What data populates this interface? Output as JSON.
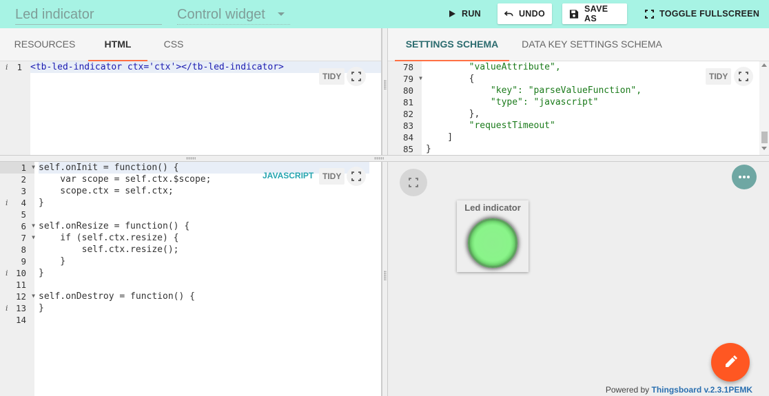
{
  "toolbar": {
    "widget_name": "Led indicator",
    "widget_type": "Control widget",
    "run_label": "RUN",
    "undo_label": "UNDO",
    "save_as_label": "SAVE AS",
    "fullscreen_label": "TOGGLE FULLSCREEN"
  },
  "html_pane": {
    "tabs": [
      "RESOURCES",
      "HTML",
      "CSS"
    ],
    "active_tab": "HTML",
    "tidy_label": "TIDY",
    "lines": [
      {
        "num": "1"
      }
    ],
    "code_text": "<tb-led-indicator ctx='ctx'></tb-led-indicator>"
  },
  "settings_pane": {
    "tabs": [
      "SETTINGS SCHEMA",
      "DATA KEY SETTINGS SCHEMA"
    ],
    "active_tab": "SETTINGS SCHEMA",
    "tidy_label": "TIDY",
    "line_numbers": [
      "78",
      "79",
      "80",
      "81",
      "82",
      "83",
      "84",
      "85"
    ],
    "code_lines": [
      "        \"valueAttribute\",",
      "        {",
      "            \"key\": \"parseValueFunction\",",
      "            \"type\": \"javascript\"",
      "        },",
      "        \"requestTimeout\"",
      "    ]",
      "}"
    ]
  },
  "js_pane": {
    "javascript_label": "JAVASCRIPT",
    "tidy_label": "TIDY",
    "line_numbers": [
      "1",
      "2",
      "3",
      "4",
      "5",
      "6",
      "7",
      "8",
      "9",
      "10",
      "11",
      "12",
      "13",
      "14"
    ],
    "code_lines": [
      "self.onInit = function() {",
      "    var scope = self.ctx.$scope;",
      "    scope.ctx = self.ctx;",
      "}",
      "",
      "self.onResize = function() {",
      "    if (self.ctx.resize) {",
      "        self.ctx.resize();",
      "    }",
      "}",
      "",
      "self.onDestroy = function() {",
      "}",
      ""
    ]
  },
  "preview": {
    "widget_title": "Led indicator",
    "led_color": "#8af48a",
    "powered_prefix": "Powered by ",
    "powered_brand": "Thingsboard v.2.3.1PEMK"
  },
  "colors": {
    "toolbar_bg": "#a7f3e4",
    "tab_indicator": "#ff7043",
    "fab": "#ff5722"
  }
}
